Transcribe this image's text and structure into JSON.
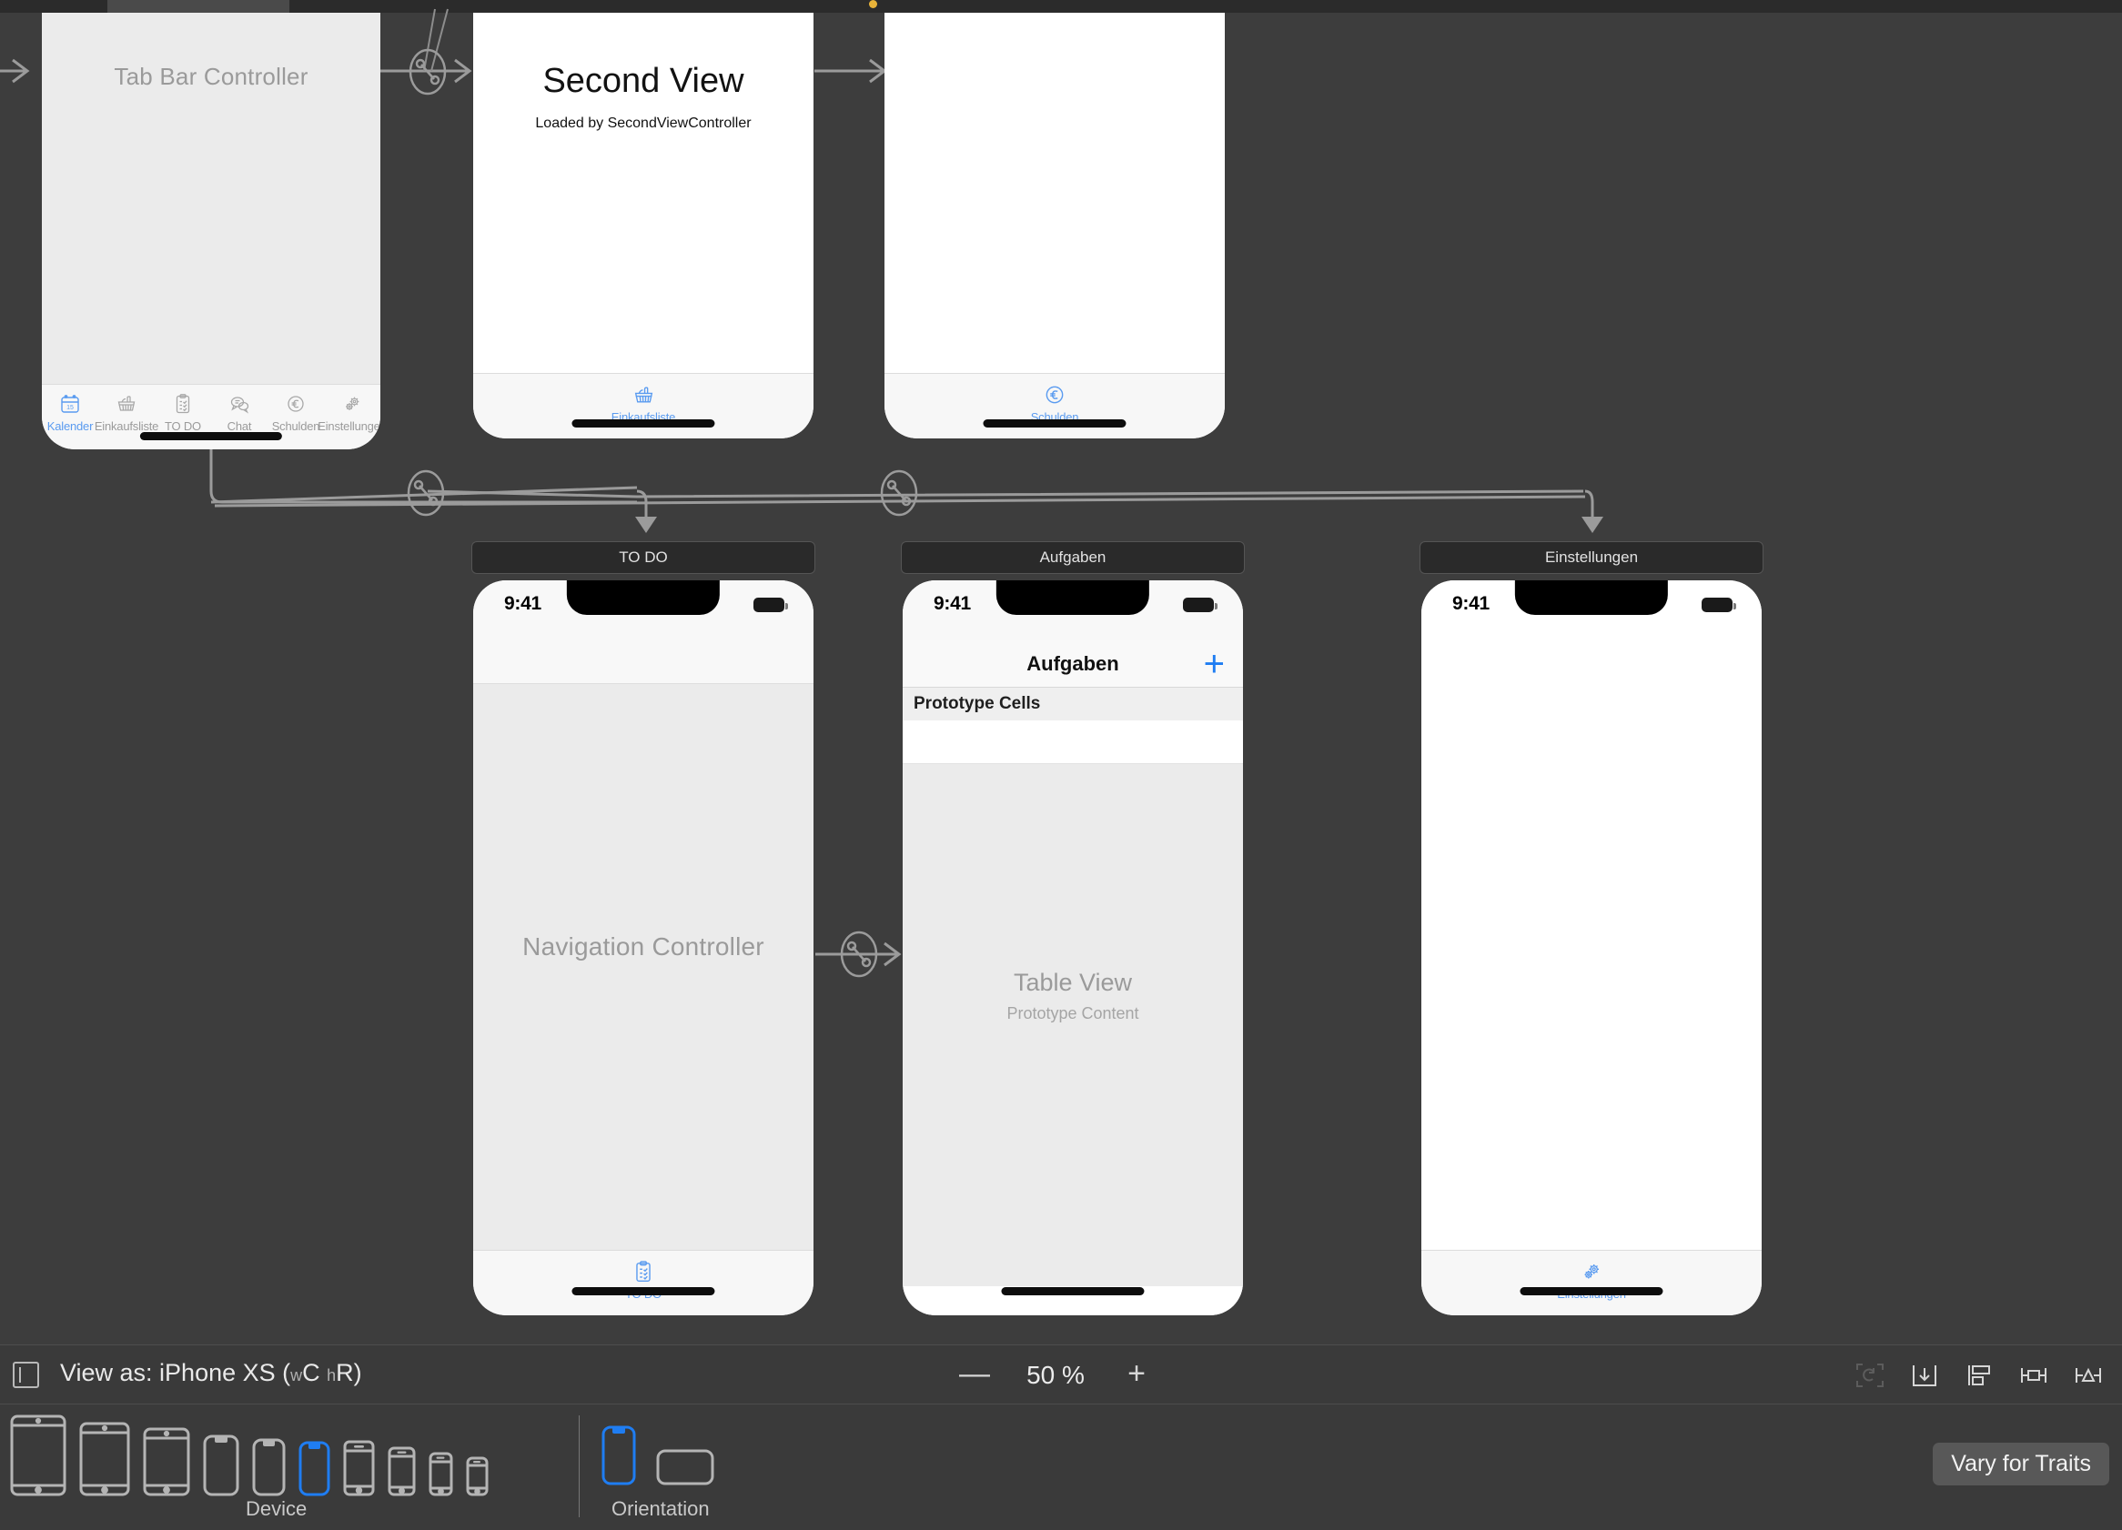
{
  "app": {
    "editor": "Xcode Interface Builder Storyboard Canvas"
  },
  "canvas": {
    "scenes": [
      {
        "id": "tab-bar-controller",
        "placeholder_label": "Tab Bar Controller",
        "tabs": [
          {
            "label": "Kalender",
            "icon": "calendar-icon",
            "selected": true
          },
          {
            "label": "Einkaufsliste",
            "icon": "basket-icon",
            "selected": false
          },
          {
            "label": "TO DO",
            "icon": "clipboard-check-icon",
            "selected": false
          },
          {
            "label": "Chat",
            "icon": "chat-bubbles-icon",
            "selected": false
          },
          {
            "label": "Schulden",
            "icon": "euro-circle-icon",
            "selected": false
          },
          {
            "label": "Einstellungen",
            "icon": "gears-icon",
            "selected": false
          }
        ]
      },
      {
        "id": "second-view-scene",
        "title": "Second View",
        "subtitle": "Loaded by SecondViewController",
        "tabs": [
          {
            "label": "Einkaufsliste",
            "icon": "basket-icon",
            "selected": true
          }
        ]
      },
      {
        "id": "schulden-scene",
        "tabs": [
          {
            "label": "Schulden",
            "icon": "euro-circle-icon",
            "selected": true
          }
        ]
      },
      {
        "id": "todo-nav-scene",
        "scene_title": "TO DO",
        "placeholder_label": "Navigation Controller",
        "status_time": "9:41",
        "tabs": [
          {
            "label": "TO DO",
            "icon": "clipboard-check-icon",
            "selected": true
          }
        ]
      },
      {
        "id": "aufgaben-scene",
        "scene_title": "Aufgaben",
        "status_time": "9:41",
        "nav_title": "Aufgaben",
        "add_button": "+",
        "section_header": "Prototype Cells",
        "table_title": "Table View",
        "table_subtitle": "Prototype Content"
      },
      {
        "id": "einstellungen-scene",
        "scene_title": "Einstellungen",
        "status_time": "9:41",
        "tabs": [
          {
            "label": "Einstellungen",
            "icon": "gears-icon",
            "selected": true
          }
        ]
      }
    ]
  },
  "view_bar": {
    "panel_toggle_icon": "left-panel-toggle-icon",
    "view_as_prefix": "View as: iPhone XS (",
    "view_as_w": "w",
    "view_as_wclass": "C",
    "view_as_h": "h",
    "view_as_hclass": "R",
    "view_as_suffix": ")",
    "zoom_out_label": "—",
    "zoom_value": "50 %",
    "zoom_in_label": "+",
    "tools": [
      {
        "name": "update-frames-icon",
        "enabled": false
      },
      {
        "name": "embed-in-icon",
        "enabled": true
      },
      {
        "name": "align-icon",
        "enabled": true
      },
      {
        "name": "add-new-constraints-icon",
        "enabled": true
      },
      {
        "name": "resolve-auto-layout-issues-icon",
        "enabled": true
      }
    ]
  },
  "device_bar": {
    "device_label": "Device",
    "orientation_label": "Orientation",
    "devices": [
      {
        "name": "ipad-pro-129",
        "kind": "tablet",
        "w": 62,
        "h": 88,
        "selected": false
      },
      {
        "name": "ipad-pro-105",
        "kind": "tablet",
        "w": 56,
        "h": 80,
        "selected": false
      },
      {
        "name": "ipad-97",
        "kind": "tablet",
        "w": 52,
        "h": 74,
        "selected": false
      },
      {
        "name": "iphone-xs-max",
        "kind": "notch",
        "w": 40,
        "h": 66,
        "selected": false
      },
      {
        "name": "iphone-xr",
        "kind": "notch",
        "w": 37,
        "h": 62,
        "selected": false
      },
      {
        "name": "iphone-xs",
        "kind": "notch",
        "w": 35,
        "h": 59,
        "selected": true
      },
      {
        "name": "iphone-8-plus",
        "kind": "home",
        "w": 35,
        "h": 60,
        "selected": false
      },
      {
        "name": "iphone-8",
        "kind": "home",
        "w": 31,
        "h": 53,
        "selected": false
      },
      {
        "name": "iphone-se",
        "kind": "home",
        "w": 27,
        "h": 47,
        "selected": false
      },
      {
        "name": "iphone-4s",
        "kind": "home",
        "w": 25,
        "h": 42,
        "selected": false
      }
    ],
    "orientations": [
      {
        "name": "portrait-icon",
        "selected": true
      },
      {
        "name": "landscape-icon",
        "selected": false
      }
    ],
    "vary_for_traits_label": "Vary for Traits"
  },
  "colors": {
    "canvas_bg": "#3d3d3d",
    "bar_bg": "#3a3a3a",
    "accent_blue": "#1f7df2",
    "tab_tint": "#5a9bf0",
    "placeholder_gray": "#9a9a9a",
    "link_gray": "#9b9b9b"
  }
}
